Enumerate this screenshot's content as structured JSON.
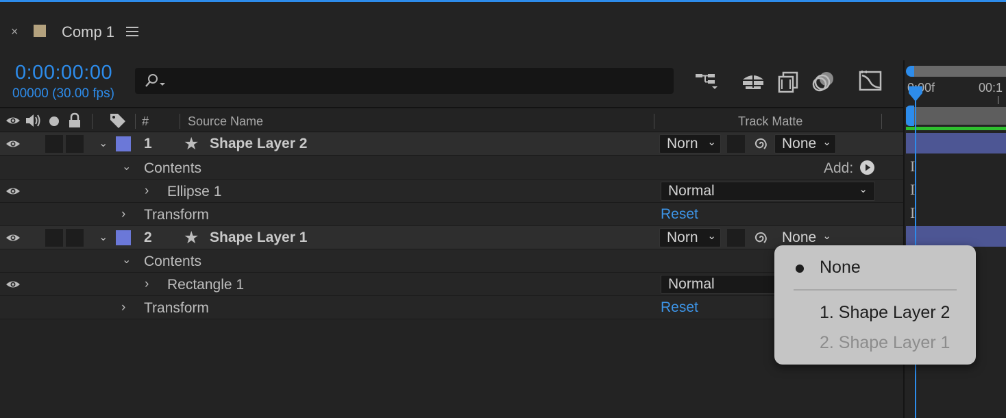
{
  "panel": {
    "close": "×",
    "title": "Comp 1"
  },
  "time": {
    "timecode": "0:00:00:00",
    "frame_fps": "00000 (30.00 fps)"
  },
  "columns": {
    "number": "#",
    "source_name": "Source Name",
    "track_matte": "Track Matte"
  },
  "layers": [
    {
      "number": "1",
      "name": "Shape Layer 2",
      "mode": "Norn",
      "matte": "None",
      "contents_label": "Contents",
      "add_label": "Add:",
      "child": "Ellipse 1",
      "child_mode": "Normal",
      "transform_label": "Transform",
      "reset_label": "Reset"
    },
    {
      "number": "2",
      "name": "Shape Layer 1",
      "mode": "Norn",
      "matte": "None",
      "contents_label": "Contents",
      "child": "Rectangle 1",
      "child_mode": "Normal",
      "transform_label": "Transform",
      "reset_label": "Reset"
    }
  ],
  "timeline": {
    "ruler_start": "0:00f",
    "ruler_next": "00:1"
  },
  "popup": {
    "items": [
      {
        "label": "None",
        "selected": true,
        "enabled": true
      },
      {
        "label": "1. Shape Layer 2",
        "selected": false,
        "enabled": true
      },
      {
        "label": "2. Shape Layer 1",
        "selected": false,
        "enabled": false
      }
    ]
  },
  "colors": {
    "accent": "#2d8ceb",
    "layer_label": "#6b78d8",
    "layer_bar": "#4d5694",
    "work_area": "#2ec02e",
    "tab_swatch": "#b4a27e"
  }
}
